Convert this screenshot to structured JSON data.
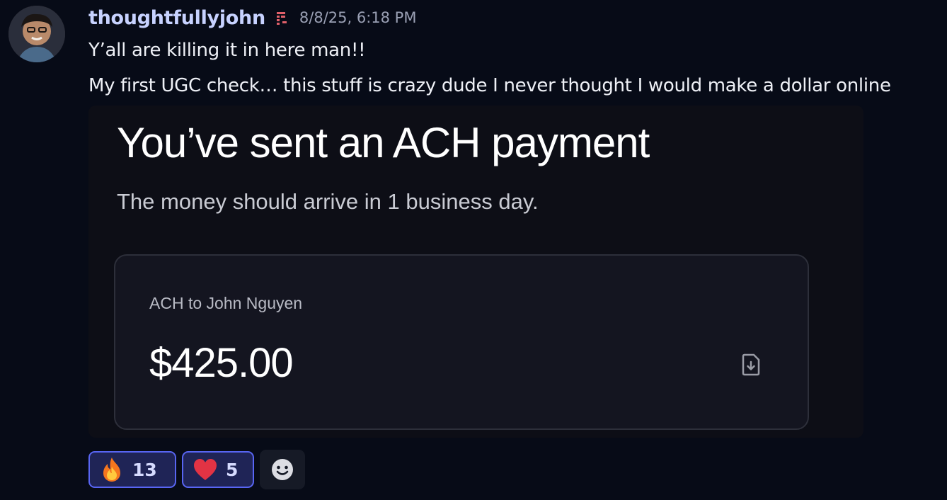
{
  "author": {
    "username": "thoughtfullyjohn",
    "timestamp": "8/8/25, 6:18 PM",
    "role_icon": "server-tag-icon",
    "avatar": "avatar"
  },
  "message": {
    "line1": "Y’all are killing it in here man!!",
    "line2": "My first UGC check… this stuff is crazy dude I never thought I would make a dollar online"
  },
  "attachment": {
    "title": "You’ve sent an ACH payment",
    "subtitle": "The money should arrive in 1 business day.",
    "payment": {
      "recipient_label": "ACH to John Nguyen",
      "amount": "$425.00",
      "icon": "download-receipt-icon"
    }
  },
  "reactions": [
    {
      "emoji": "fire-emoji",
      "count": "13"
    },
    {
      "emoji": "red-heart-emoji",
      "count": "5"
    }
  ],
  "add_reaction_icon": "add-reaction-smiley-icon",
  "colors": {
    "background": "#070b17",
    "username": "#c7d2ff",
    "reaction_active_border": "#5865f2",
    "reaction_active_bg": "#1f2456"
  }
}
